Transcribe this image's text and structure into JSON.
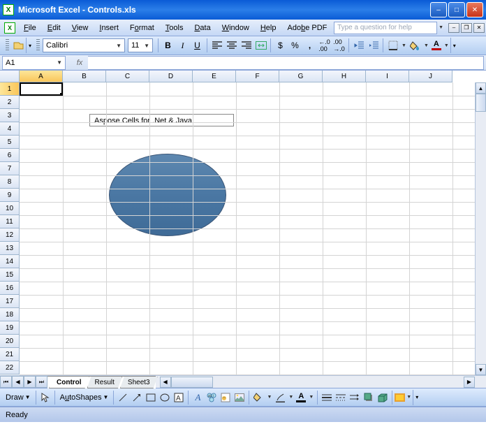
{
  "window": {
    "title": "Microsoft Excel - Controls.xls"
  },
  "menus": {
    "file": "File",
    "edit": "Edit",
    "view": "View",
    "insert": "Insert",
    "format": "Format",
    "tools": "Tools",
    "data": "Data",
    "window": "Window",
    "help": "Help",
    "adobe_pdf": "Adobe PDF",
    "question_placeholder": "Type a question for help"
  },
  "formatting": {
    "font_name": "Calibri",
    "font_size": "11",
    "currency_symbol": "$",
    "percent_symbol": "%",
    "comma_symbol": ",",
    "decimal_inc": ".0",
    "decimal_dec": ".00"
  },
  "name_box": {
    "value": "A1"
  },
  "fx_label": "fx",
  "columns": [
    "A",
    "B",
    "C",
    "D",
    "E",
    "F",
    "G",
    "H",
    "I",
    "J"
  ],
  "rows": [
    "1",
    "2",
    "3",
    "4",
    "5",
    "6",
    "7",
    "8",
    "9",
    "10",
    "11",
    "12",
    "13",
    "14",
    "15",
    "16",
    "17",
    "18",
    "19",
    "20",
    "21",
    "22"
  ],
  "active_cell": "A1",
  "textbox": {
    "text": "Aspose.Cells for .Net  & Java"
  },
  "sheet_tabs": {
    "tabs": [
      "Control",
      "Result",
      "Sheet3"
    ],
    "active": "Control"
  },
  "drawing_toolbar": {
    "draw_label": "Draw",
    "autoshapes_label": "AutoShapes"
  },
  "statusbar": {
    "text": "Ready"
  },
  "colors": {
    "oval_fill": "#4a77a3",
    "font_btn_bar": "#c00000",
    "fill_btn": "#ffcc00"
  }
}
